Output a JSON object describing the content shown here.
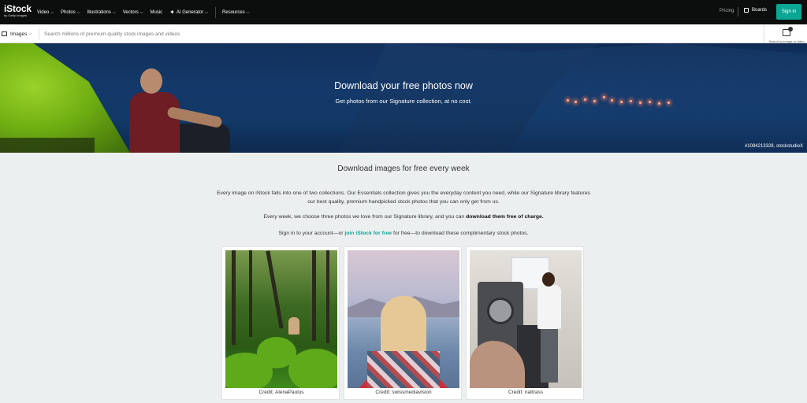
{
  "nav": {
    "logo": "iStock",
    "logo_sub": "by Getty Images",
    "items": [
      {
        "label": "Video",
        "has_dropdown": true
      },
      {
        "label": "Photos",
        "has_dropdown": true
      },
      {
        "label": "Illustrations",
        "has_dropdown": true
      },
      {
        "label": "Vectors",
        "has_dropdown": true
      },
      {
        "label": "Music",
        "has_dropdown": false
      },
      {
        "label": "AI Generator",
        "has_dropdown": true,
        "icon": "sparkle-icon"
      },
      {
        "label": "Resources",
        "has_dropdown": true
      }
    ],
    "pricing": "Pricing",
    "boards": "Boards",
    "signin": "Sign in"
  },
  "search": {
    "type_selector": "Images",
    "placeholder": "Search millions of premium-quality stock images and videos",
    "visual_search_label": "Search by image or video"
  },
  "hero": {
    "title": "Download your free photos now",
    "subtitle": "Get photos from our Signature collection, at no cost.",
    "credit": "#1084213328, stockstudioX"
  },
  "content": {
    "title": "Download images for free every week",
    "p1": "Every image on iStock falls into one of two collections. Our Essentials collection gives you the everyday content you need, while our Signature library features our best quality, premium handpicked stock photos that you can only get from us.",
    "p2_text": "Every week, we choose three photos we love from our Signature library, and you can ",
    "p2_bold": "download them free of charge.",
    "p3_pre": "Sign in to your account—or ",
    "p3_link": "join iStock for free",
    "p3_post": " for free—to download these complimentary stock photos."
  },
  "cards": [
    {
      "credit": "Credit: AlenaPaulus"
    },
    {
      "credit": "Credit: swissmediavision"
    },
    {
      "credit": "Credit: nattrass"
    }
  ],
  "colors": {
    "accent": "#0ba694",
    "nav_bg": "#0c0d0d",
    "page_bg": "#eceff0"
  }
}
